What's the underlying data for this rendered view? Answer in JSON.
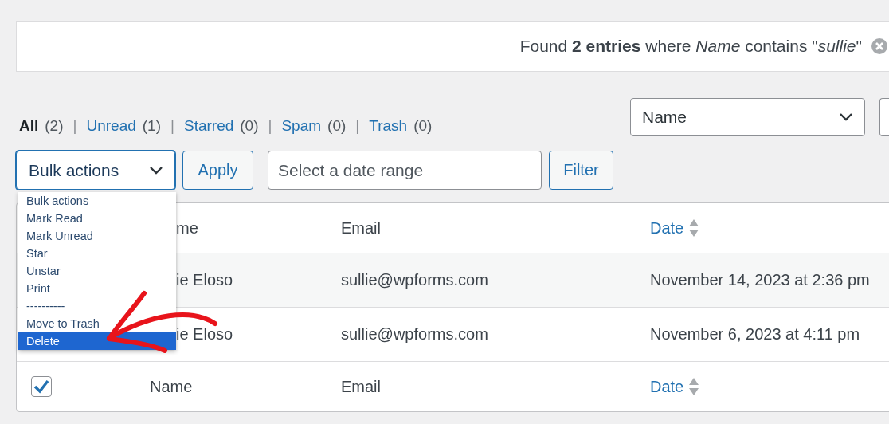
{
  "notice": {
    "text": "Found **2 entries** where *Name* contains \"*sullie*\""
  },
  "views": [
    {
      "label": "All",
      "count": "(2)",
      "selected": true
    },
    {
      "separator": "|",
      "label": "Unread",
      "count": "(1)",
      "selected": false
    },
    {
      "separator": "|",
      "label": "Starred",
      "count": "(0)",
      "selected": false
    },
    {
      "separator": "|",
      "label": "Spam",
      "count": "(0)",
      "selected": false
    },
    {
      "separator": "|",
      "label": "Trash",
      "count": "(0)",
      "selected": false
    }
  ],
  "field_select": {
    "value": "Name"
  },
  "toolbar": {
    "bulk_select": {
      "value": "Bulk actions",
      "expanded": true
    },
    "apply_button": "Apply",
    "date_field": {
      "placeholder": "Select a date range"
    },
    "filter_button": "Filter"
  },
  "bulk_options": [
    {
      "label": "Bulk actions",
      "selected": false
    },
    {
      "label": "Mark Read",
      "selected": false
    },
    {
      "label": "Mark Unread",
      "selected": false
    },
    {
      "label": "Star",
      "selected": false
    },
    {
      "label": "Unstar",
      "selected": false
    },
    {
      "label": "Print",
      "selected": false
    },
    {
      "label": "----------",
      "selected": false
    },
    {
      "label": "Move to Trash",
      "selected": false
    },
    {
      "label": "Delete",
      "selected": true
    }
  ],
  "table": {
    "columns": [
      {
        "label": "me",
        "sortable": false
      },
      {
        "label": "Email",
        "sortable": false
      },
      {
        "label": "Date",
        "sortable": true
      }
    ],
    "rows": [
      {
        "hovered": true,
        "cells": [
          "ie Eloso",
          "sullie@wpforms.com",
          "November 14, 2023 at 2:36 pm"
        ]
      },
      {
        "hovered": false,
        "cells": [
          "ie Eloso",
          "sullie@wpforms.com",
          "November 6, 2023 at 4:11 pm"
        ]
      }
    ],
    "footer": {
      "checked": true,
      "columns": [
        {
          "label": "Name",
          "sortable": false
        },
        {
          "label": "Email",
          "sortable": false
        },
        {
          "label": "Date",
          "sortable": true
        }
      ]
    }
  }
}
